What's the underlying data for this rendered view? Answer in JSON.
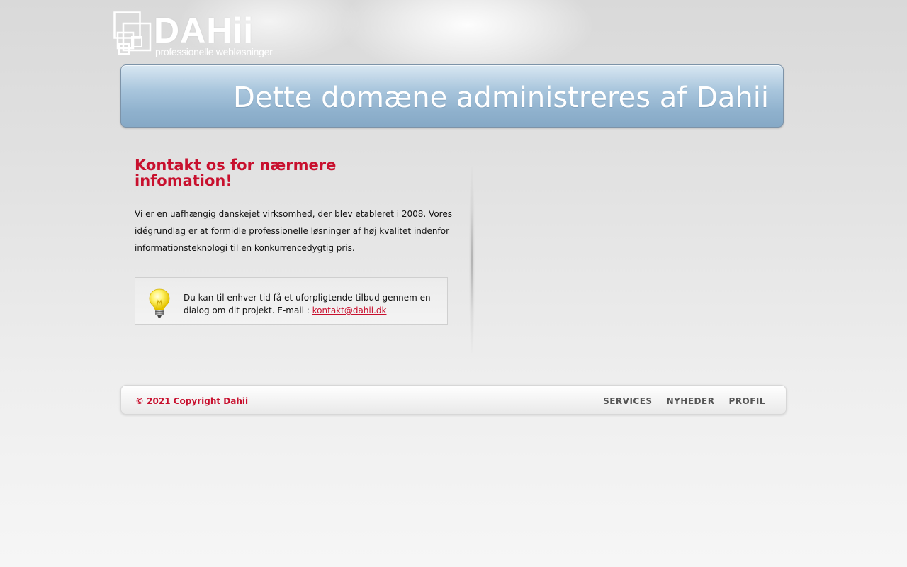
{
  "logo": {
    "word": "DAHii",
    "tagline": "professionelle webløsninger",
    "mark_icon": "overlapping-squares-icon"
  },
  "banner": {
    "title": "Dette domæne administreres af Dahii"
  },
  "content": {
    "heading": "Kontakt os for nærmere infomation!",
    "paragraph": "Vi er en uafhængig danskejet virksomhed, der blev etableret i 2008. Vores idégrundlag er at formidle professionelle løsninger af høj kvalitet indenfor informationsteknologi til en konkurrencedygtig pris."
  },
  "info_box": {
    "icon": "lightbulb-icon",
    "text": "Du kan til enhver tid få et uforpligtende tilbud gennem en dialog om dit projekt. E-mail : ",
    "email": "kontakt@dahii.dk"
  },
  "footer": {
    "copyright_text": "© 2021 Copyright ",
    "copyright_link": "Dahii",
    "nav": [
      "SERVICES",
      "NYHEDER",
      "PROFIL"
    ]
  },
  "colors": {
    "accent": "#c8102e",
    "banner_blue": "#8fb1cd"
  }
}
